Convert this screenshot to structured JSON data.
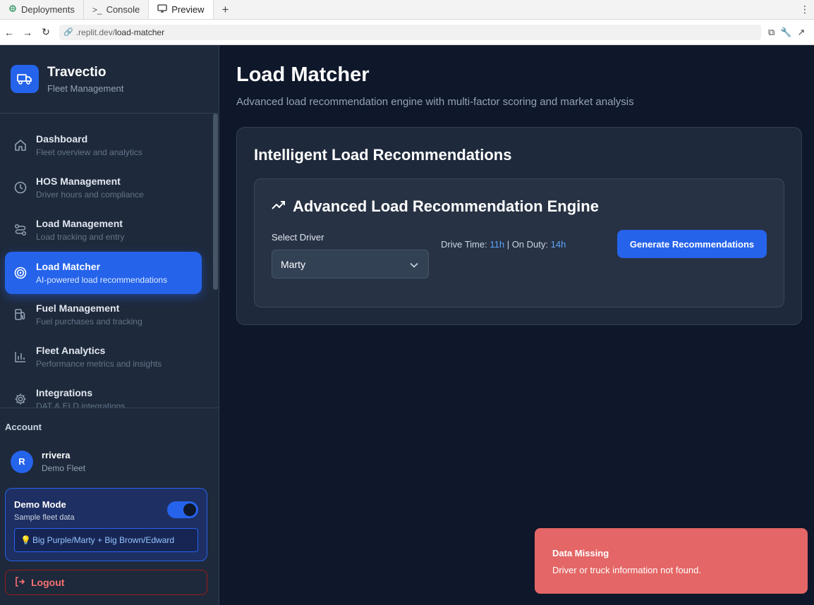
{
  "browser": {
    "tabs": [
      {
        "label": "Deployments",
        "icon": "deploy-icon"
      },
      {
        "label": "Console",
        "icon": "terminal-icon"
      },
      {
        "label": "Preview",
        "icon": "monitor-icon",
        "active": true
      }
    ],
    "url_prefix": ".replit.dev/",
    "url_path": "load-matcher"
  },
  "sidebar": {
    "brand_title": "Travectio",
    "brand_sub": "Fleet Management",
    "items": [
      {
        "title": "Dashboard",
        "sub": "Fleet overview and analytics",
        "icon": "home-icon"
      },
      {
        "title": "HOS Management",
        "sub": "Driver hours and compliance",
        "icon": "clock-icon"
      },
      {
        "title": "Load Management",
        "sub": "Load tracking and entry",
        "icon": "route-icon"
      },
      {
        "title": "Load Matcher",
        "sub": "AI-powered load recommendations",
        "icon": "target-icon",
        "active": true
      },
      {
        "title": "Fuel Management",
        "sub": "Fuel purchases and tracking",
        "icon": "fuel-icon"
      },
      {
        "title": "Fleet Analytics",
        "sub": "Performance metrics and insights",
        "icon": "bar-chart-icon"
      },
      {
        "title": "Integrations",
        "sub": "DAT & ELD integrations",
        "icon": "gear-icon"
      }
    ],
    "account_label": "Account",
    "user": {
      "initial": "R",
      "name": "rrivera",
      "fleet": "Demo Fleet"
    },
    "demo": {
      "title": "Demo Mode",
      "sub": "Sample fleet data",
      "note": "Big Purple/Marty + Big Brown/Edward",
      "enabled": true
    },
    "logout_label": "Logout"
  },
  "main": {
    "title": "Load Matcher",
    "subtitle": "Advanced load recommendation engine with multi-factor scoring and market analysis",
    "card_title": "Intelligent Load Recommendations",
    "engine_title": "Advanced Load Recommendation Engine",
    "select_label": "Select Driver",
    "selected_driver": "Marty",
    "drive_time_label": "Drive Time: ",
    "drive_time": "11h",
    "separator": " | ",
    "on_duty_label": "On Duty: ",
    "on_duty": "14h",
    "generate_label": "Generate Recommendations"
  },
  "toast": {
    "title": "Data Missing",
    "message": "Driver or truck information not found."
  },
  "colors": {
    "accent": "#2563eb",
    "sidebar_bg": "#1e293b",
    "main_bg": "#0f172a",
    "toast_bg": "#e46666",
    "value_blue": "#60a5fa"
  }
}
